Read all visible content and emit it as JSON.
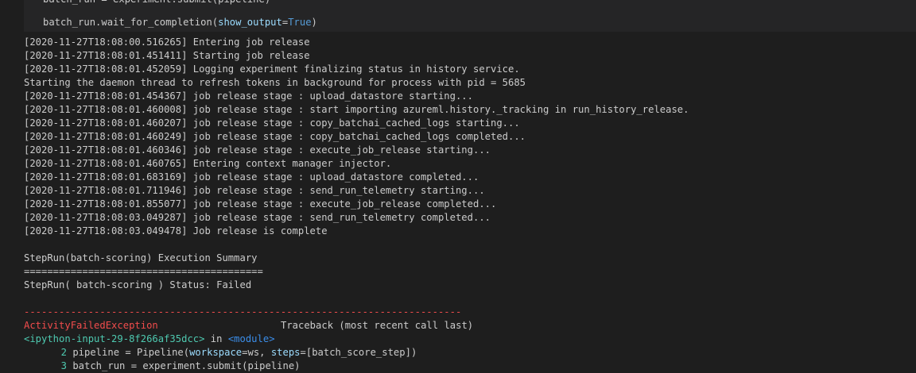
{
  "input_cell": {
    "line0": "batch_run = experiment.submit(pipeline)",
    "line1_pre": "batch_run.wait_for_completion(",
    "line1_kw": "show_output",
    "line1_eq": "=",
    "line1_val": "True",
    "line1_post": ")"
  },
  "log_lines": [
    "[2020-11-27T18:08:00.516265] Entering job release",
    "[2020-11-27T18:08:01.451411] Starting job release",
    "[2020-11-27T18:08:01.452059] Logging experiment finalizing status in history service.",
    "Starting the daemon thread to refresh tokens in background for process with pid = 5685",
    "[2020-11-27T18:08:01.454367] job release stage : upload_datastore starting...",
    "[2020-11-27T18:08:01.460008] job release stage : start importing azureml.history._tracking in run_history_release.",
    "[2020-11-27T18:08:01.460207] job release stage : copy_batchai_cached_logs starting...",
    "[2020-11-27T18:08:01.460249] job release stage : copy_batchai_cached_logs completed...",
    "[2020-11-27T18:08:01.460346] job release stage : execute_job_release starting...",
    "[2020-11-27T18:08:01.460765] Entering context manager injector.",
    "[2020-11-27T18:08:01.683169] job release stage : upload_datastore completed...",
    "[2020-11-27T18:08:01.711946] job release stage : send_run_telemetry starting...",
    "[2020-11-27T18:08:01.855077] job release stage : execute_job_release completed...",
    "[2020-11-27T18:08:03.049287] job release stage : send_run_telemetry completed...",
    "[2020-11-27T18:08:03.049478] Job release is complete"
  ],
  "summary": {
    "title": "StepRun(batch-scoring) Execution Summary",
    "rule": "=========================================",
    "status": "StepRun( batch-scoring ) Status: Failed"
  },
  "traceback": {
    "dash_rule": "---------------------------------------------------------------------------",
    "exception_name": "ActivityFailedException",
    "header": "Traceback (most recent call last)",
    "input_ref": "<ipython-input-29-8f266af35dcc>",
    "in_word": " in ",
    "module_ref": "<module>",
    "line2": {
      "num": "2",
      "pre": " pipeline = Pipeline(",
      "kw1": "workspace",
      "mid1": "=ws, ",
      "kw2": "steps",
      "mid2": "=[batch_score_step]",
      "post": ")"
    },
    "line3": {
      "num": "3",
      "pre": " batch_run = experiment.submit(pipeline)"
    }
  },
  "colors": {
    "background": "#1e1e1e",
    "input_background": "#252526",
    "text": "#cccccc",
    "error_red": "#f14c4c",
    "ansi_green": "#4ec9b0",
    "ansi_blue": "#3b8eea"
  }
}
